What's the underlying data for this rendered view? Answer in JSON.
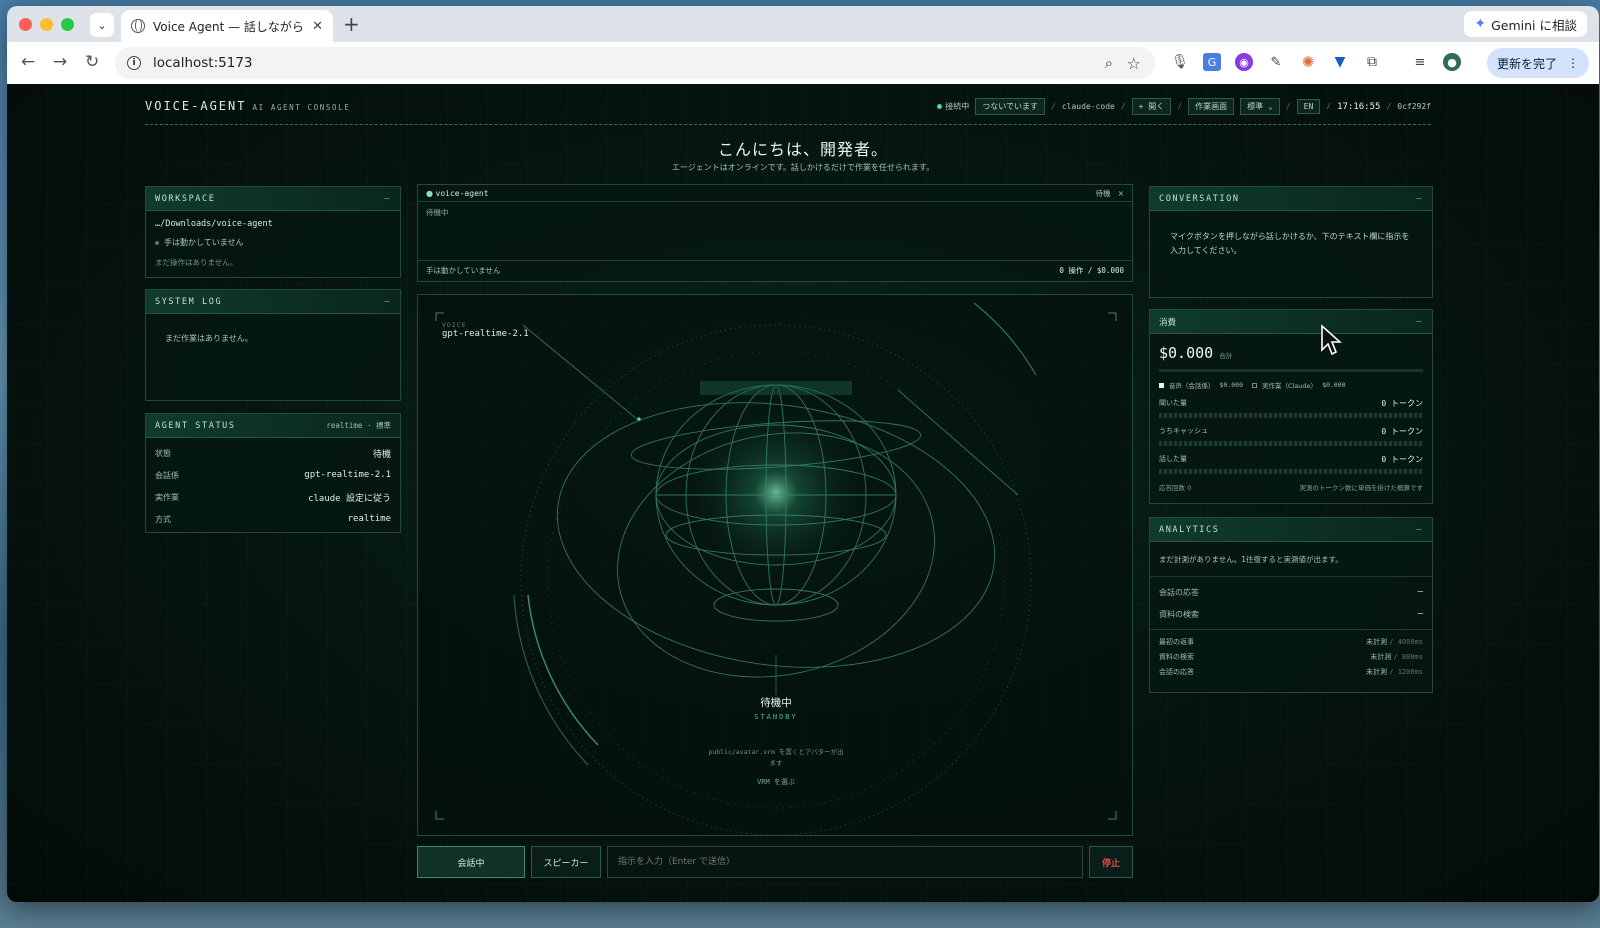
{
  "browser": {
    "tab_title": "Voice Agent — 話しながら開発",
    "new_tab": "+",
    "gemini_label": "Gemini に相談",
    "url": "localhost:5173",
    "update_label": "更新を完了"
  },
  "header": {
    "brand": "VOICE-AGENT",
    "brand_sub": "AI AGENT CONSOLE",
    "connection": "接続中",
    "connected_chip": "つないでいます",
    "agent_name": "claude-code",
    "open_button": "+ 開く",
    "work_screen": "作業画面",
    "mode_select": "標準",
    "lang": "EN",
    "clock": "17:16:55",
    "hash": "0cf292f"
  },
  "greeting": {
    "title": "こんにちは、開発者。",
    "subtitle": "エージェントはオンラインです。話しかけるだけで作業を任せられます。"
  },
  "workspace": {
    "title": "WORKSPACE",
    "path": "…/Downloads/voice-agent",
    "hands": "手は動かしていません",
    "ops": "まだ操作はありません。"
  },
  "system_log": {
    "title": "SYSTEM LOG",
    "empty": "まだ作業はありません。"
  },
  "agent_status": {
    "title": "AGENT STATUS",
    "meta": "realtime · 標準",
    "rows": [
      {
        "k": "状態",
        "v": "待機"
      },
      {
        "k": "会話係",
        "v": "gpt-realtime-2.1"
      },
      {
        "k": "実作業",
        "v": "claude 設定に従う"
      },
      {
        "k": "方式",
        "v": "realtime"
      }
    ]
  },
  "terminal": {
    "title": "voice-agent",
    "state": "待機",
    "close": "×",
    "body": "待機中",
    "footer_left": "手は動かしていません",
    "footer_right": "0 操作 / $0.000"
  },
  "stage": {
    "voice_label": "VOICE",
    "model": "gpt-realtime-2.1",
    "state_jp": "待機中",
    "state_en": "STANDBY",
    "hint": "public/avatar.vrm を置くとアバターが出ます",
    "vrm_link": "VRM を選ぶ"
  },
  "conversation": {
    "title": "CONVERSATION",
    "text": "マイクボタンを押しながら話しかけるか、下のテキスト欄に指示を入力してください。"
  },
  "cost": {
    "title": "消費",
    "total": "$0.000",
    "total_label": "合計",
    "voice": "音声（会話係）",
    "voice_val": "$0.000",
    "work": "実作業（Claude）",
    "work_val": "$0.000",
    "rows": [
      {
        "k": "聞いた量",
        "v": "0 トークン"
      },
      {
        "k": "うちキャッシュ",
        "v": "0 トークン"
      },
      {
        "k": "話した量",
        "v": "0 トークン"
      }
    ],
    "count": "応答回数 0",
    "note": "実測のトークン数に単価を掛けた概算です"
  },
  "analytics": {
    "title": "ANALYTICS",
    "empty": "まだ計測がありません。1往復すると実測値が出ます。",
    "rows": [
      {
        "k": "会話の応答",
        "v": "—"
      },
      {
        "k": "資料の検索",
        "v": "—"
      }
    ],
    "targets": [
      {
        "k": "最初の返事",
        "v": "未計測",
        "t": "/ 4000ms"
      },
      {
        "k": "資料の検索",
        "v": "未計測",
        "t": "/ 800ms"
      },
      {
        "k": "会話の応答",
        "v": "未計測",
        "t": "/ 1200ms"
      }
    ]
  },
  "controls": {
    "talk": "会話中",
    "speaker": "スピーカー",
    "input_placeholder": "指示を入力（Enter で送信）",
    "stop": "停止"
  },
  "colors": {
    "accent": "#4fd89d",
    "stop": "#e04848"
  }
}
